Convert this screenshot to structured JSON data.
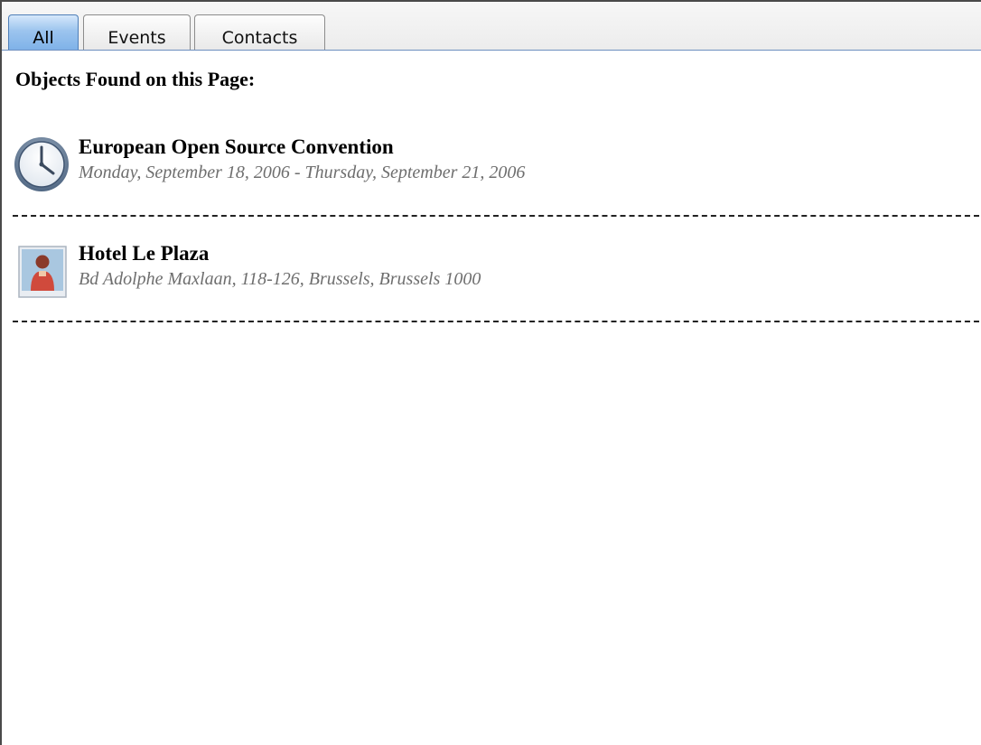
{
  "tabs": [
    {
      "label": "All",
      "active": true
    },
    {
      "label": "Events",
      "active": false
    },
    {
      "label": "Contacts",
      "active": false
    }
  ],
  "main": {
    "heading": "Objects Found on this Page:",
    "items": [
      {
        "type": "event",
        "icon": "clock-icon",
        "title": "European Open Source Convention",
        "subtitle": "Monday, September 18, 2006 - Thursday, September 21, 2006"
      },
      {
        "type": "contact",
        "icon": "contact-person-icon",
        "title": "Hotel Le Plaza",
        "subtitle": "Bd Adolphe Maxlaan, 118-126, Brussels, Brussels 1000"
      }
    ]
  },
  "colors": {
    "active_tab": "#9cc4ee",
    "tab_border_active": "#4f7fb8",
    "subtitle_text": "#6e6e6e"
  }
}
